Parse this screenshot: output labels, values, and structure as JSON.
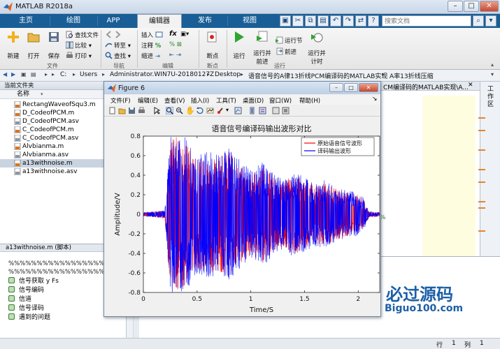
{
  "app": {
    "title": "MATLAB R2018a"
  },
  "window_controls": {
    "minimize": "–",
    "maximize": "□",
    "close": "✕"
  },
  "tabs": [
    "主页",
    "绘图",
    "APP",
    "编辑器",
    "发布",
    "视图"
  ],
  "search": {
    "placeholder": "搜索文档"
  },
  "ribbon": {
    "new": "新建",
    "open": "打开",
    "save": "保存",
    "find_files": "查找文件",
    "compare": "比较",
    "print": "打印",
    "insert": "插入",
    "comment": "注释",
    "indent": "缩进",
    "goto": "转至",
    "find": "查找",
    "breakpoint": "断点",
    "run": "运行",
    "run_advance": [
      "运行并",
      "前进"
    ],
    "run_section": "运行节",
    "advance": "前进",
    "run_time": [
      "运行并",
      "计时"
    ],
    "groups": {
      "file": "文件",
      "navigate": "导航",
      "edit": "编辑",
      "breakpoints": "断点",
      "run": "运行"
    }
  },
  "address": [
    "C:",
    "Users",
    "Administrator.WIN7U-20180127Z",
    "Desktop",
    "语音信号的A律13折线PCM编译码的MATLAB实现",
    "A率13折线压缩"
  ],
  "editor_tab": "CM编译码的MATLAB实现\\A...",
  "current_folder": {
    "title": "当前文件夹",
    "column": "名称",
    "files": [
      {
        "name": "RectangWaveofSqu3.m"
      },
      {
        "name": "D_CodeofPCM.m"
      },
      {
        "name": "D_CodeofPCM.asv"
      },
      {
        "name": "C_CodeofPCM.m"
      },
      {
        "name": "C_CodeofPCM.asv"
      },
      {
        "name": "Alvbianma.m"
      },
      {
        "name": "Alvbianma.asv"
      },
      {
        "name": "a13withnoise.m"
      },
      {
        "name": "a13withnoise.asv"
      }
    ]
  },
  "details": {
    "title": "a13withnoise.m (脚本)",
    "pct1": "%%%%%%%%%%%%%%%%%%%%%%%",
    "pct2": "%%%%%%%%%%%%%%%%%%%%%%",
    "cells": [
      "信号获取 y Fs",
      "信号编码",
      "信道",
      "信号译码",
      "遇到的问题"
    ]
  },
  "right_panel": {
    "label": "工作区"
  },
  "status": {
    "row_label": "行",
    "row": "1",
    "col_label": "列",
    "col": "1"
  },
  "figure": {
    "title": "Figure 6",
    "menu": [
      "文件(F)",
      "编辑(E)",
      "查看(V)",
      "插入(I)",
      "工具(T)",
      "桌面(D)",
      "窗口(W)",
      "帮助(H)"
    ]
  },
  "chart_data": {
    "type": "line",
    "title": "语音信号编译码输出波形对比",
    "xlabel": "Time/S",
    "ylabel": "Amplitude/V",
    "xlim": [
      0,
      2.2
    ],
    "ylim": [
      -0.8,
      0.8
    ],
    "xticks": [
      0,
      0.5,
      1,
      1.5,
      2
    ],
    "xtick_labels": [
      "0",
      "0.5",
      "1",
      "1.5",
      "2"
    ],
    "yticks": [
      -0.8,
      -0.6,
      -0.4,
      -0.2,
      0,
      0.2,
      0.4,
      0.6,
      0.8
    ],
    "ytick_labels": [
      "-0.8",
      "-0.6",
      "-0.4",
      "-0.2",
      "0",
      "0.2",
      "0.4",
      "0.6",
      "0.8"
    ],
    "legend_position": "top-right",
    "grid": false,
    "series": [
      {
        "name": "原始语音信号波形",
        "color": "#ff0000",
        "envelope_t": [
          0,
          0.1,
          0.2,
          0.25,
          0.3,
          0.4,
          0.5,
          0.6,
          0.7,
          0.8,
          0.9,
          1.0,
          1.1,
          1.2,
          1.3,
          1.4,
          1.5,
          1.6,
          1.7,
          1.8,
          1.9,
          2.0,
          2.05,
          2.1,
          2.2
        ],
        "envelope_amp": [
          0.02,
          0.03,
          0.04,
          0.75,
          0.8,
          0.75,
          0.55,
          0.6,
          0.58,
          0.65,
          0.5,
          0.42,
          0.5,
          0.4,
          0.32,
          0.42,
          0.35,
          0.3,
          0.32,
          0.26,
          0.22,
          0.2,
          0.15,
          0.03,
          0.02
        ]
      },
      {
        "name": "译码输出波形",
        "color": "#0000ff",
        "envelope_t": [
          0,
          0.1,
          0.2,
          0.25,
          0.3,
          0.4,
          0.5,
          0.6,
          0.7,
          0.8,
          0.9,
          1.0,
          1.1,
          1.2,
          1.3,
          1.4,
          1.5,
          1.6,
          1.7,
          1.8,
          1.9,
          2.0,
          2.05,
          2.1,
          2.2
        ],
        "envelope_amp": [
          0.02,
          0.03,
          0.04,
          0.8,
          0.8,
          0.8,
          0.6,
          0.65,
          0.62,
          0.68,
          0.55,
          0.45,
          0.55,
          0.44,
          0.36,
          0.45,
          0.38,
          0.33,
          0.35,
          0.28,
          0.25,
          0.22,
          0.17,
          0.03,
          0.02
        ]
      }
    ]
  },
  "watermark": {
    "brand": "必过源码",
    "site": "Biguo100.com"
  },
  "colors": {
    "tabbar": "#195e96",
    "accent_orange": "#e6842a",
    "raw": "#ff0000",
    "decoded": "#0000ff"
  }
}
